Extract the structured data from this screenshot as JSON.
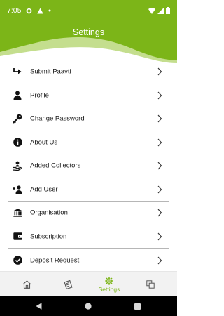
{
  "status_bar": {
    "time": "7:05",
    "icons": [
      "gear-icon",
      "warning-icon",
      "dot-icon",
      "wifi-icon",
      "signal-icon",
      "battery-icon"
    ]
  },
  "header": {
    "title": "Settings",
    "color": "#7cb518"
  },
  "menu": {
    "items": [
      {
        "label": "Submit Paavti",
        "icon": "submit-arrow-icon"
      },
      {
        "label": "Profile",
        "icon": "person-icon"
      },
      {
        "label": "Change Password",
        "icon": "key-icon"
      },
      {
        "label": "About Us",
        "icon": "info-icon"
      },
      {
        "label": "Added Collectors",
        "icon": "hand-user-icon"
      },
      {
        "label": "Add User",
        "icon": "person-add-icon"
      },
      {
        "label": "Organisation",
        "icon": "bank-icon"
      },
      {
        "label": "Subscription",
        "icon": "wallet-icon"
      },
      {
        "label": "Deposit Request",
        "icon": "check-circle-icon"
      }
    ]
  },
  "bottom_nav": {
    "items": [
      {
        "label": "",
        "icon": "home-icon",
        "active": false
      },
      {
        "label": "",
        "icon": "receipt-icon",
        "active": false
      },
      {
        "label": "Settings",
        "icon": "gear-icon",
        "active": true
      },
      {
        "label": "",
        "icon": "copy-icon",
        "active": false
      }
    ],
    "active_color": "#7cb518"
  },
  "system_nav": [
    "back-icon",
    "home-circle-icon",
    "recents-icon"
  ]
}
